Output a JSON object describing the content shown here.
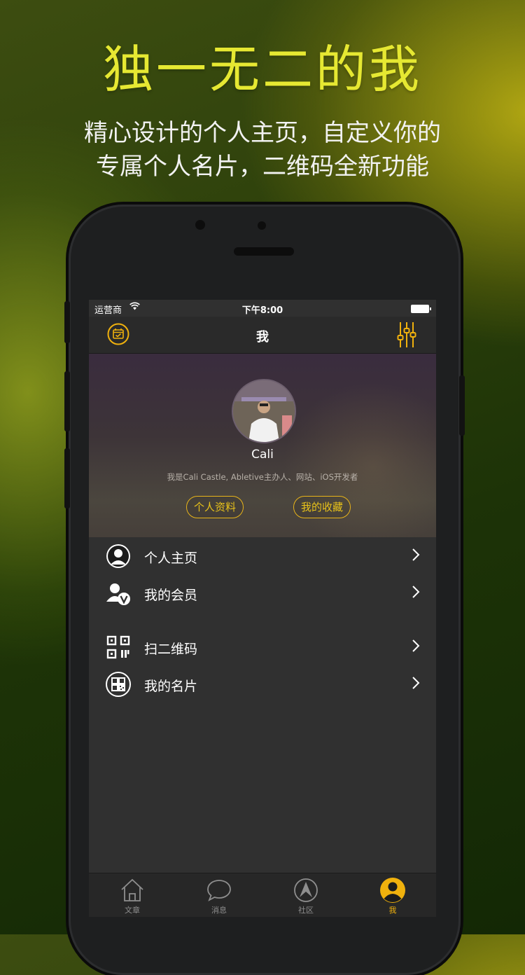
{
  "promo": {
    "headline": "独一无二的我",
    "subline_1": "精心设计的个人主页，自定义你的",
    "subline_2": "专属个人名片，二维码全新功能"
  },
  "status_bar": {
    "carrier": "运营商",
    "time": "下午8:00"
  },
  "navbar": {
    "title": "我",
    "left_icon": "calendar-icon",
    "right_icon": "sliders-icon"
  },
  "profile": {
    "name": "Cali",
    "bio": "我是Cali Castle, Abletive主办人、网站、iOS开发者",
    "button_info": "个人资料",
    "button_favorites": "我的收藏"
  },
  "menu": [
    {
      "label": "个人主页",
      "icon": "user-avatar-icon"
    },
    {
      "label": "我的会员",
      "icon": "member-v-icon"
    },
    {
      "label": "扫二维码",
      "icon": "qr-scan-icon"
    },
    {
      "label": "我的名片",
      "icon": "qr-card-icon"
    }
  ],
  "tabbar": [
    {
      "label": "文章",
      "icon": "home-icon",
      "active": false
    },
    {
      "label": "消息",
      "icon": "chat-bubble-icon",
      "active": false
    },
    {
      "label": "社区",
      "icon": "abletive-logo-icon",
      "active": false
    },
    {
      "label": "我",
      "icon": "user-icon",
      "active": true
    }
  ],
  "colors": {
    "accent": "#f0b10d",
    "headline": "#e6e832",
    "screen_bg": "#303030"
  }
}
